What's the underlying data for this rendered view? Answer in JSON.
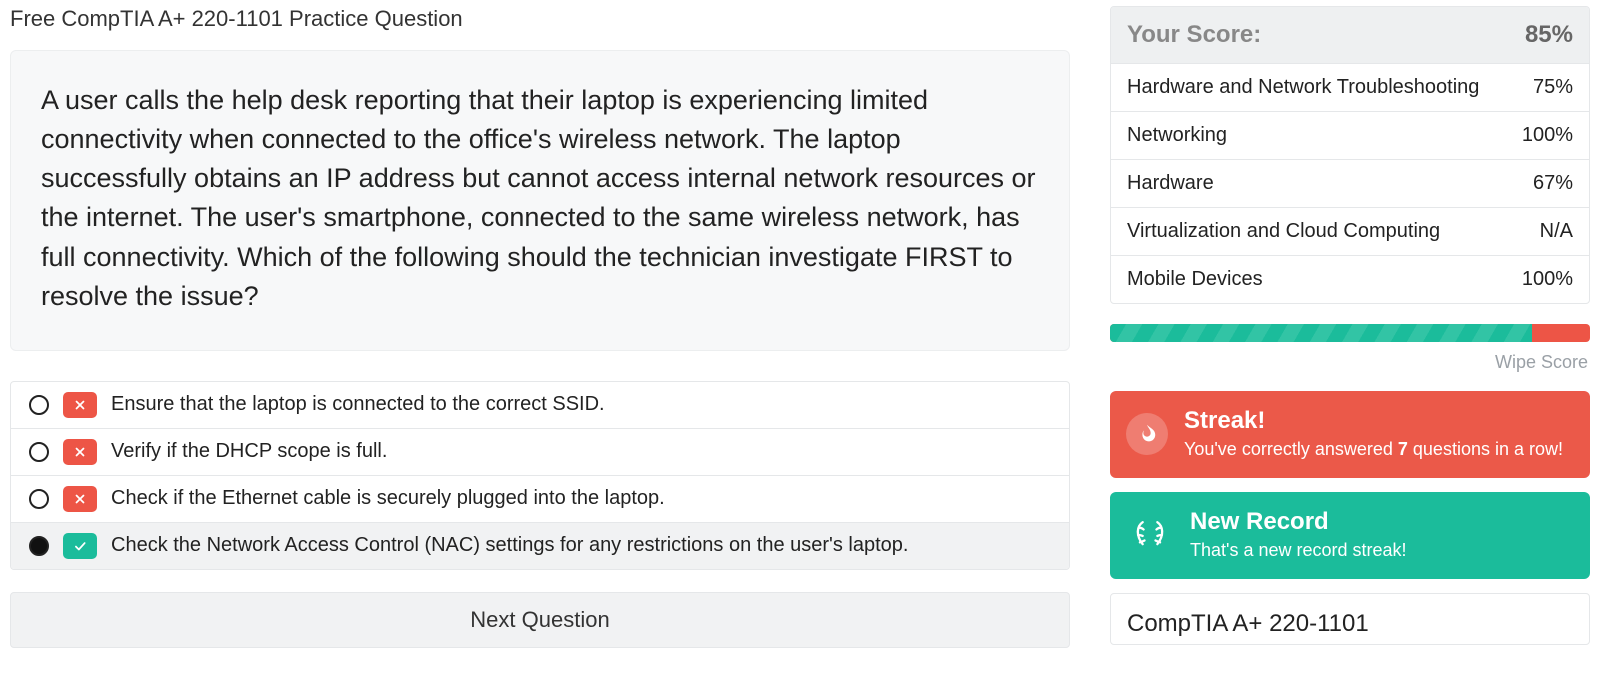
{
  "page_title": "Free CompTIA A+ 220-1101 Practice Question",
  "question": "A user calls the help desk reporting that their laptop is experiencing limited connectivity when connected to the office's wireless network. The laptop successfully obtains an IP address but cannot access internal network resources or the internet. The user's smartphone, connected to the same wireless network, has full connectivity. Which of the following should the technician investigate FIRST to resolve the issue?",
  "answers": [
    {
      "text": "Ensure that the laptop is connected to the correct SSID.",
      "correct": false,
      "selected": false
    },
    {
      "text": "Verify if the DHCP scope is full.",
      "correct": false,
      "selected": false
    },
    {
      "text": "Check if the Ethernet cable is securely plugged into the laptop.",
      "correct": false,
      "selected": false
    },
    {
      "text": "Check the Network Access Control (NAC) settings for any restrictions on the user's laptop.",
      "correct": true,
      "selected": true
    }
  ],
  "next_button": "Next Question",
  "score": {
    "title": "Your Score:",
    "overall": "85%",
    "categories": [
      {
        "name": "Hardware and Network Troubleshooting",
        "value": "75%"
      },
      {
        "name": "Networking",
        "value": "100%"
      },
      {
        "name": "Hardware",
        "value": "67%"
      },
      {
        "name": "Virtualization and Cloud Computing",
        "value": "N/A"
      },
      {
        "name": "Mobile Devices",
        "value": "100%"
      }
    ],
    "progress_pct": 88
  },
  "wipe_label": "Wipe Score",
  "streak": {
    "title": "Streak!",
    "prefix": "You've correctly answered ",
    "count": "7",
    "suffix": " questions in a row!"
  },
  "record": {
    "title": "New Record",
    "subtitle": "That's a new record streak!"
  },
  "exam_label": "CompTIA A+ 220-1101"
}
